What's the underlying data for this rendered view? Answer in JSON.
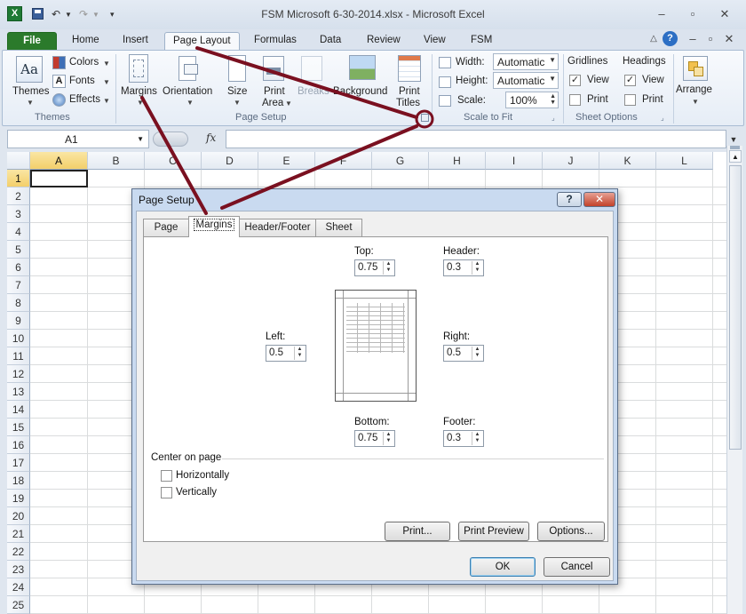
{
  "window": {
    "title": "FSM Microsoft 6-30-2014.xlsx - Microsoft Excel",
    "controls": [
      "minimize",
      "restore",
      "close"
    ]
  },
  "quick_access": {
    "app_icon": "X",
    "icons": [
      "save-icon",
      "undo-icon",
      "redo-icon",
      "customize-icon"
    ]
  },
  "tabs": [
    {
      "label": "File"
    },
    {
      "label": "Home"
    },
    {
      "label": "Insert"
    },
    {
      "label": "Page Layout",
      "active": true
    },
    {
      "label": "Formulas"
    },
    {
      "label": "Data"
    },
    {
      "label": "Review"
    },
    {
      "label": "View"
    },
    {
      "label": "FSM"
    }
  ],
  "ribbon": {
    "themes": {
      "themes": "Themes",
      "colors": "Colors",
      "fonts": "Fonts",
      "effects": "Effects",
      "group": "Themes"
    },
    "page_setup": {
      "margins": "Margins",
      "orientation": "Orientation",
      "size": "Size",
      "print_area_1": "Print",
      "print_area_2": "Area",
      "breaks": "Breaks",
      "background": "Background",
      "print_titles_1": "Print",
      "print_titles_2": "Titles",
      "group": "Page Setup"
    },
    "scale": {
      "width_label": "Width:",
      "width_value": "Automatic",
      "height_label": "Height:",
      "height_value": "Automatic",
      "scale_label": "Scale:",
      "scale_value": "100%",
      "group": "Scale to Fit"
    },
    "sheet_options": {
      "gridlines": "Gridlines",
      "headings": "Headings",
      "view": "View",
      "print": "Print",
      "gridlines_view_checked": true,
      "headings_view_checked": true,
      "group": "Sheet Options"
    },
    "arrange": {
      "label": "Arrange"
    }
  },
  "formula_bar": {
    "name_box": "A1",
    "fx": "fx",
    "value": ""
  },
  "sheet": {
    "columns": [
      "A",
      "B",
      "C",
      "D",
      "E",
      "F",
      "G",
      "H",
      "I",
      "J",
      "K",
      "L"
    ],
    "rows": [
      "1",
      "2",
      "3",
      "4",
      "5",
      "6",
      "7",
      "8",
      "9",
      "10",
      "11",
      "12",
      "13",
      "14",
      "15",
      "16",
      "17",
      "18",
      "19",
      "20",
      "21",
      "22",
      "23",
      "24",
      "25"
    ],
    "selected_cell": "A1"
  },
  "dialog": {
    "title": "Page Setup",
    "help": "?",
    "tabs": [
      {
        "label": "Page"
      },
      {
        "label": "Margins",
        "active": true
      },
      {
        "label": "Header/Footer"
      },
      {
        "label": "Sheet"
      }
    ],
    "margins": {
      "top_label": "Top:",
      "top": "0.75",
      "header_label": "Header:",
      "header": "0.3",
      "left_label": "Left:",
      "left": "0.5",
      "right_label": "Right:",
      "right": "0.5",
      "bottom_label": "Bottom:",
      "bottom": "0.75",
      "footer_label": "Footer:",
      "footer": "0.3"
    },
    "center_on_page": {
      "label": "Center on page",
      "horizontally": "Horizontally",
      "vertically": "Vertically",
      "horizontally_checked": false,
      "vertically_checked": false
    },
    "buttons": {
      "print": "Print...",
      "print_preview": "Print Preview",
      "options": "Options...",
      "ok": "OK",
      "cancel": "Cancel"
    }
  },
  "colors": {
    "file_tab": "#2b7a2b",
    "callout": "#7a1020",
    "selected_header": "#f3cf6a"
  }
}
